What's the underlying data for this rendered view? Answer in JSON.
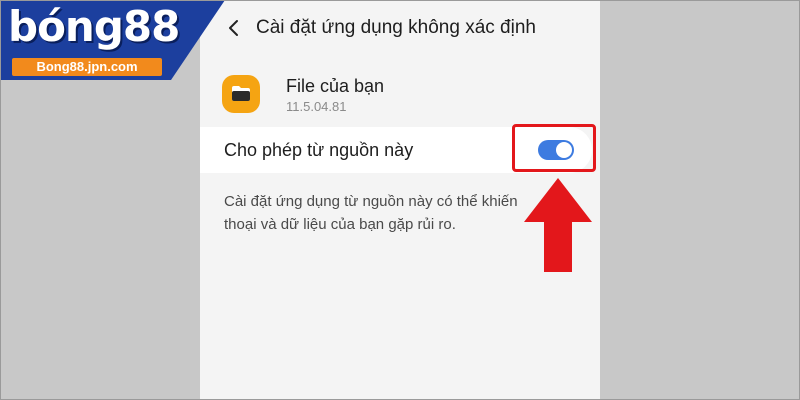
{
  "header": {
    "title": "Cài đặt ứng dụng không xác định",
    "back_icon": "chevron-left-icon"
  },
  "app": {
    "name": "File của bạn",
    "version": "11.5.04.81",
    "icon": "folder-icon",
    "icon_color": "#f5a412"
  },
  "setting": {
    "label": "Cho phép từ nguồn này",
    "toggle_on": true,
    "toggle_color": "#3d7be0"
  },
  "description": "Cài đặt ứng dụng từ nguồn này có thể khiến thoại và dữ liệu của bạn gặp rủi ro.",
  "logo": {
    "text": "bóng88",
    "url": "Bong88.jpn.com",
    "bar_color": "#1c3f9e",
    "url_color": "#f28a1c"
  },
  "annotation": {
    "color": "#e3171b",
    "arrow_icon": "up-arrow-icon"
  }
}
